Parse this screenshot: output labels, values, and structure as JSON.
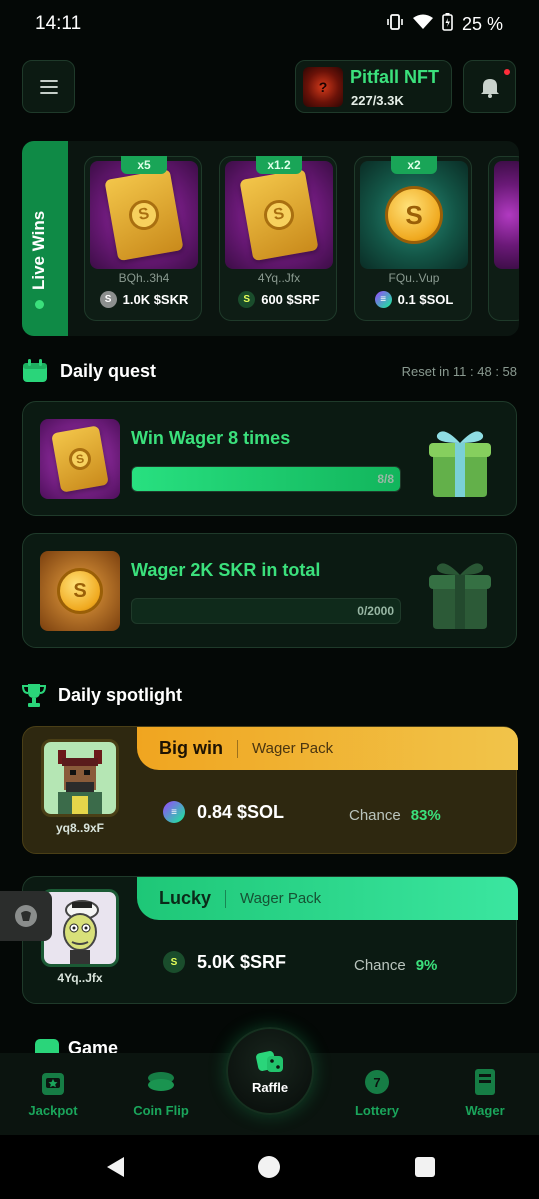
{
  "status": {
    "time": "14:11",
    "battery": "25 %"
  },
  "header": {
    "nft_title": "Pitfall NFT",
    "nft_count": "227/3.3K",
    "nft_thumb_glyph": "?"
  },
  "live_wins": {
    "label": "Live Wins",
    "cards": [
      {
        "multiplier": "x5",
        "user": "BQh..3h4",
        "amount": "1.0K $SKR",
        "coin": "skr",
        "image": "gold-pack"
      },
      {
        "multiplier": "x1.2",
        "user": "4Yq..Jfx",
        "amount": "600 $SRF",
        "coin": "srf",
        "image": "gold-pack"
      },
      {
        "multiplier": "x2",
        "user": "FQu..Vup",
        "amount": "0.1 $SOL",
        "coin": "sol",
        "image": "gold-coin"
      }
    ]
  },
  "daily_quest": {
    "title": "Daily quest",
    "reset": "Reset in 11 : 48 : 58",
    "quests": [
      {
        "title": "Win Wager 8 times",
        "progress_text": "8/8",
        "progress": 1.0
      },
      {
        "title": "Wager 2K SKR in total",
        "progress_text": "0/2000",
        "progress": 0.0
      }
    ]
  },
  "spotlight": {
    "title": "Daily spotlight",
    "items": [
      {
        "badge": "Big win",
        "type": "Wager Pack",
        "user": "yq8..9xF",
        "amount": "0.84 $SOL",
        "chance_label": "Chance",
        "chance": "83%"
      },
      {
        "badge": "Lucky",
        "type": "Wager Pack",
        "user": "4Yq..Jfx",
        "amount": "5.0K $SRF",
        "chance_label": "Chance",
        "chance": "9%"
      }
    ]
  },
  "game_peek": "Game",
  "nav": {
    "jackpot": "Jackpot",
    "coin_flip": "Coin Flip",
    "raffle": "Raffle",
    "lottery": "Lottery",
    "wager": "Wager"
  },
  "colors": {
    "accent": "#3be07c",
    "gold": "#f0a520",
    "background": "#040806"
  },
  "icons": [
    "menu-icon",
    "bell-icon",
    "calendar-icon",
    "trophy-icon",
    "dice-icon",
    "back-icon",
    "home-icon",
    "recents-icon"
  ]
}
